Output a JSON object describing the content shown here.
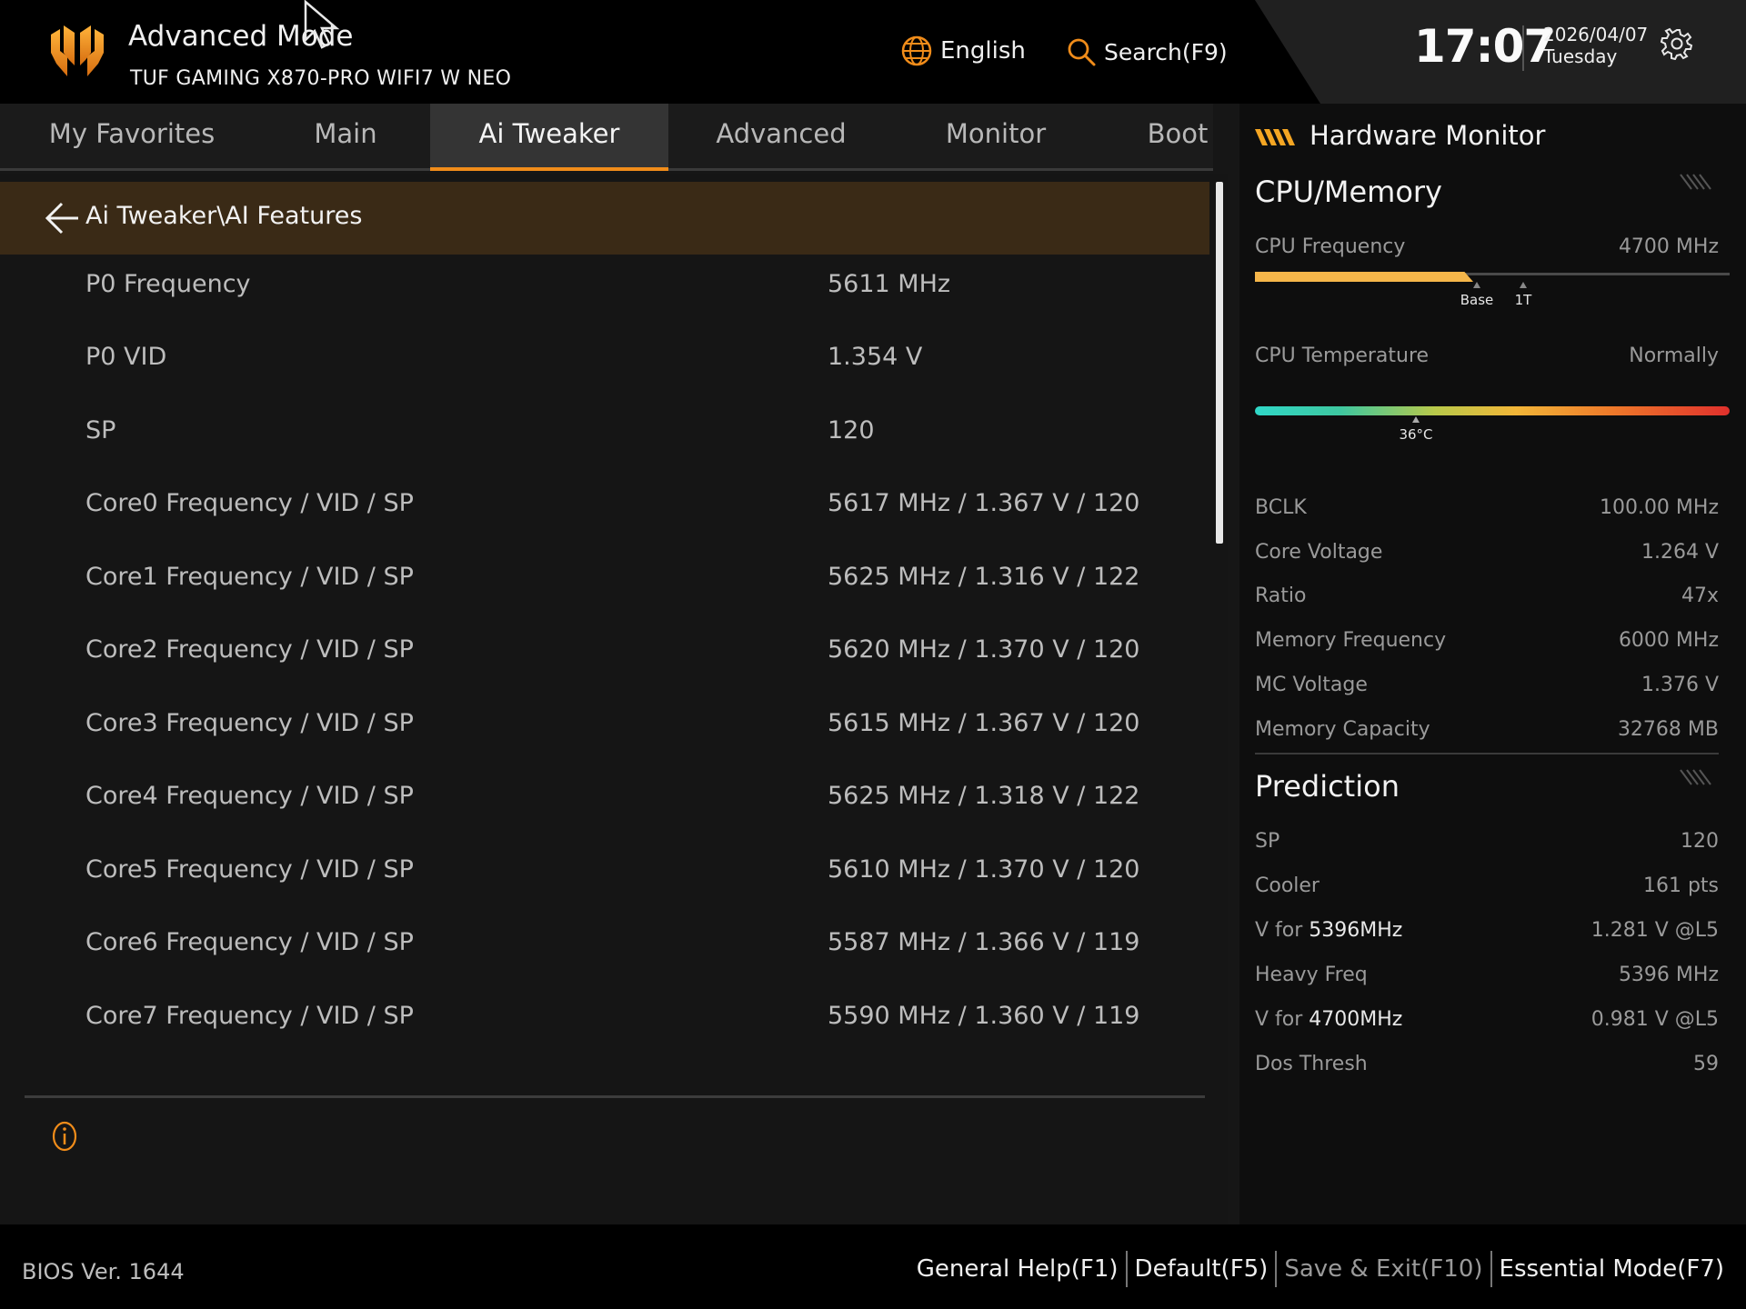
{
  "header": {
    "mode_title": "Advanced Mode",
    "board_name": "TUF GAMING X870-PRO WIFI7 W NEO",
    "language": "English",
    "search": "Search(F9)",
    "time": "17:07",
    "date": "2026/04/07",
    "weekday": "Tuesday",
    "icons": [
      "tuf-logo-icon",
      "globe-icon",
      "search-icon",
      "gear-icon",
      "mouse-cursor-icon"
    ]
  },
  "tabs": [
    {
      "label": "My Favorites",
      "active": false
    },
    {
      "label": "Main",
      "active": false
    },
    {
      "label": "Ai Tweaker",
      "active": true
    },
    {
      "label": "Advanced",
      "active": false
    },
    {
      "label": "Monitor",
      "active": false
    },
    {
      "label": "Boot",
      "active": false
    }
  ],
  "breadcrumb": "Ai Tweaker\\AI Features",
  "rows": [
    {
      "label": "P0 Frequency",
      "value": "5611 MHz"
    },
    {
      "label": "P0 VID",
      "value": "1.354 V"
    },
    {
      "label": "SP",
      "value": "120"
    },
    {
      "label": "Core0 Frequency / VID / SP",
      "value": "5617 MHz / 1.367 V / 120"
    },
    {
      "label": "Core1 Frequency / VID / SP",
      "value": "5625 MHz / 1.316 V / 122"
    },
    {
      "label": "Core2 Frequency / VID / SP",
      "value": "5620 MHz / 1.370 V / 120"
    },
    {
      "label": "Core3 Frequency / VID / SP",
      "value": "5615 MHz / 1.367 V / 120"
    },
    {
      "label": "Core4 Frequency / VID / SP",
      "value": "5625 MHz / 1.318 V / 122"
    },
    {
      "label": "Core5 Frequency / VID / SP",
      "value": "5610 MHz / 1.370 V / 120"
    },
    {
      "label": "Core6 Frequency / VID / SP",
      "value": "5587 MHz / 1.366 V / 119"
    },
    {
      "label": "Core7 Frequency / VID / SP",
      "value": "5590 MHz / 1.360 V / 119"
    }
  ],
  "hw_monitor": {
    "title": "Hardware Monitor",
    "cpu_memory": {
      "title": "CPU/Memory",
      "cpu_frequency_label": "CPU Frequency",
      "cpu_frequency_value": "4700 MHz",
      "cpu_frequency_fill": 0.46,
      "marker_base": "Base",
      "marker_1t": "1T",
      "cpu_temp_label": "CPU Temperature",
      "cpu_temp_status": "Normally",
      "cpu_temp_value": "36°C",
      "cpu_temp_position": 0.34,
      "items": [
        {
          "label": "BCLK",
          "value": "100.00 MHz"
        },
        {
          "label": "Core Voltage",
          "value": "1.264 V"
        },
        {
          "label": "Ratio",
          "value": "47x"
        },
        {
          "label": "Memory Frequency",
          "value": "6000 MHz"
        },
        {
          "label": "MC Voltage",
          "value": "1.376 V"
        },
        {
          "label": "Memory Capacity",
          "value": "32768 MB"
        }
      ]
    },
    "prediction": {
      "title": "Prediction",
      "sp_label": "SP",
      "sp_value": "120",
      "cooler_label": "Cooler",
      "cooler_value": "161 pts",
      "v_for_prefix": "V for",
      "v_heavy_freq": "5396MHz",
      "v_heavy_value": "1.281 V @L5",
      "heavy_freq_label": "Heavy Freq",
      "heavy_freq_value": "5396 MHz",
      "v_light_freq": "4700MHz",
      "v_light_value": "0.981 V @L5",
      "dos_thresh_label": "Dos Thresh",
      "dos_thresh_value": "59"
    }
  },
  "footer": {
    "bios_version": "BIOS Ver. 1644",
    "actions": [
      "General Help(F1)",
      "Default(F5)",
      "Save & Exit(F10)",
      "Essential Mode(F7)"
    ]
  },
  "colors": {
    "accent": "#f08c1a",
    "breadcrumb_bg": "#3a2a16",
    "freq_bar": "#f5b64a"
  }
}
